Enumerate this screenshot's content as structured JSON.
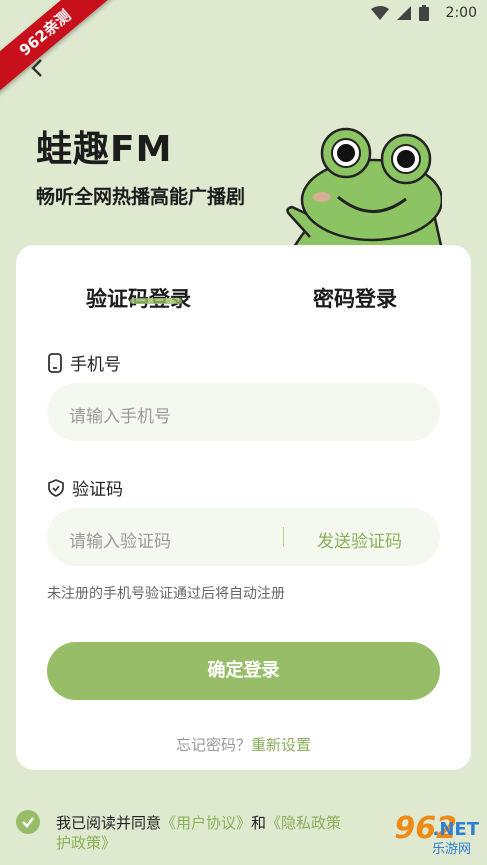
{
  "status": {
    "time": "2:00"
  },
  "ribbon_text": "962亲测",
  "nav": {
    "back_icon": "chevron-left-icon"
  },
  "brand": {
    "title": "蛙趣FM",
    "slogan": "畅听全网热播高能广播剧"
  },
  "tabs": [
    {
      "label": "验证码登录",
      "active": true
    },
    {
      "label": "密码登录",
      "active": false
    }
  ],
  "phone": {
    "label": "手机号",
    "placeholder": "请输入手机号",
    "icon": "phone-icon"
  },
  "code": {
    "label": "验证码",
    "placeholder": "请输入验证码",
    "send_label": "发送验证码",
    "icon": "shield-icon"
  },
  "hint": "未注册的手机号验证通过后将自动注册",
  "submit_label": "确定登录",
  "forgot": {
    "text": "忘记密码？",
    "reset": "重新设置"
  },
  "agreement": {
    "prefix": "我已阅读并同意",
    "user_agreement": "《用户协议》",
    "and": "和",
    "privacy_policy_line1": "《隐私政策",
    "privacy_policy_line2": "护政策》",
    "checked": true
  },
  "watermark": {
    "brand": "962",
    "net": ".NET",
    "sub": "乐游网"
  },
  "colors": {
    "background": "#dfe9cf",
    "accent": "#98bd68",
    "card": "#ffffff",
    "link": "#8ab05a",
    "ribbon": "#c8101c"
  }
}
